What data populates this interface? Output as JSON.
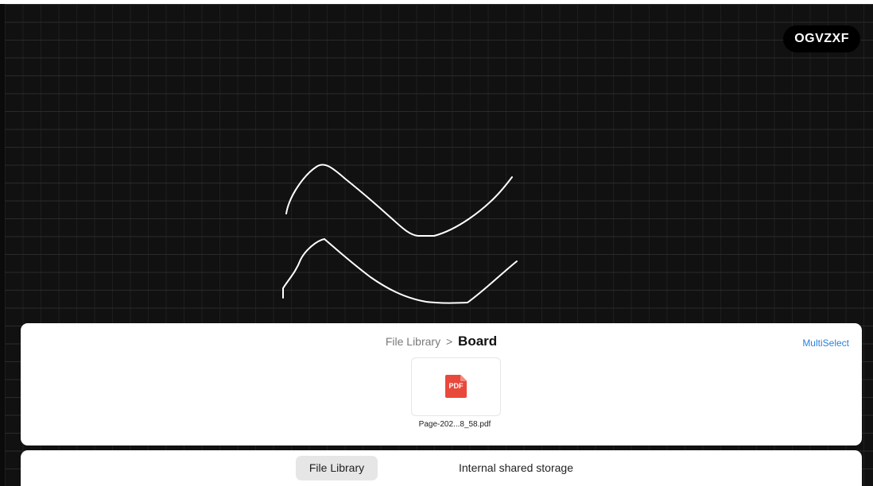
{
  "canvas": {
    "background_color": "#111111",
    "room_code": "OGVZXF",
    "stroke_color": "#ffffff"
  },
  "file_panel": {
    "breadcrumb_root": "File Library",
    "breadcrumb_separator": ">",
    "breadcrumb_current": "Board",
    "multiselect_label": "MultiSelect",
    "files": [
      {
        "name": "Page-202...8_58.pdf",
        "icon": "pdf-icon",
        "icon_label": "PDF"
      }
    ]
  },
  "bottom_tabs": [
    {
      "label": "File Library",
      "active": true
    },
    {
      "label": "Internal shared storage",
      "active": false
    }
  ],
  "colors": {
    "accent": "#2b82d9",
    "pdf_red": "#e9493b"
  }
}
